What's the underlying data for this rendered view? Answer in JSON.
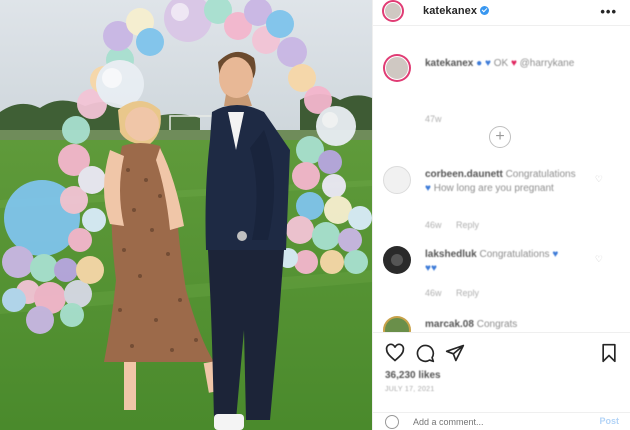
{
  "post": {
    "username": "katekanex",
    "photo_alt": "Couple standing in front of pastel balloon arch"
  },
  "caption": {
    "username": "katekanex",
    "text_parts": [
      "OK",
      "@harrykane"
    ],
    "time": "47w"
  },
  "comments": [
    {
      "username": "corbeen.daunett",
      "text": "Congratulations",
      "text2": "How long are you pregnant",
      "time": "46w",
      "reply_label": "Reply"
    },
    {
      "username": "lakshedluk",
      "text": "Congratulations",
      "time": "46w",
      "reply_label": "Reply"
    },
    {
      "username": "marcak.08",
      "text": "Congrats"
    }
  ],
  "engagement": {
    "likes": "36,230 likes",
    "date": "JULY 17, 2021"
  },
  "add_comment": {
    "placeholder": "Add a comment...",
    "post_label": "Post"
  },
  "colors": {
    "accent_blue": "#3897f0",
    "post_button_disabled": "#b3d4f7",
    "story_ring": "#e03c74"
  },
  "icons": [
    "more-icon",
    "verified-icon",
    "heart-icon",
    "comment-icon",
    "share-icon",
    "bookmark-icon",
    "emoji-icon",
    "load-more-icon"
  ]
}
